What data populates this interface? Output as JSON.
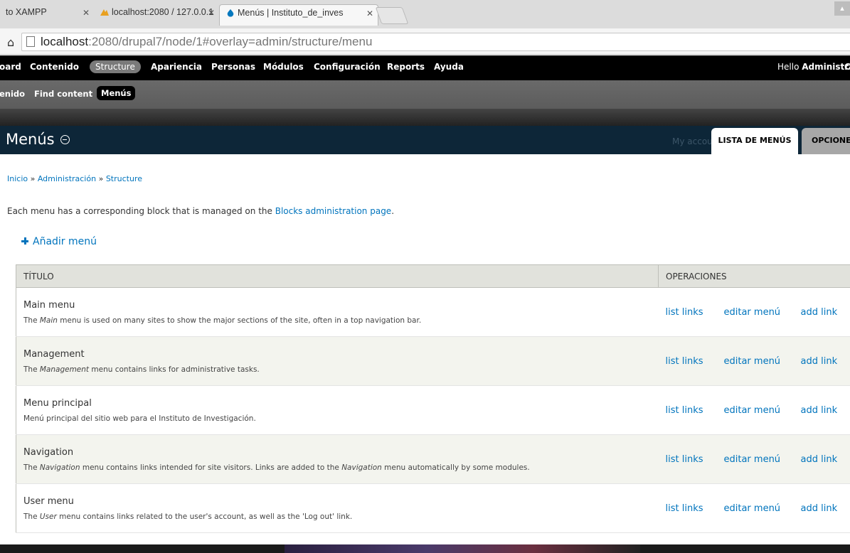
{
  "browser": {
    "tabs": [
      {
        "label": "to XAMPP"
      },
      {
        "label": "localhost:2080 / 127.0.0.1"
      },
      {
        "label": "Menús | Instituto_de_inves"
      }
    ],
    "url_host": "localhost",
    "url_rest": ":2080/drupal7/node/1#overlay=admin/structure/menu"
  },
  "toolbar": {
    "items": [
      "oard",
      "Contenido",
      "Structure",
      "Apariencia",
      "Personas",
      "Módulos",
      "Configuración",
      "Reports",
      "Ayuda"
    ],
    "hello_prefix": "Hello ",
    "hello_user": "Administrador",
    "trailing": "C"
  },
  "shortcuts": {
    "items": [
      "enido",
      "Find content",
      "Menús"
    ]
  },
  "overlay": {
    "title": "Menús",
    "my_account": "My account",
    "tabs": [
      "LISTA DE MENÚS",
      "OPCIONES"
    ]
  },
  "breadcrumb": {
    "items": [
      "Inicio",
      "Administración",
      "Structure"
    ],
    "separator": "»"
  },
  "help": {
    "before": "Each menu has a corresponding block that is managed on the ",
    "link": "Blocks administration page",
    "after": "."
  },
  "add_menu_label": "Añadir menú",
  "table": {
    "headers": [
      "TÍTULO",
      "OPERACIONES"
    ],
    "op_labels": [
      "list links",
      "editar menú",
      "add link"
    ],
    "rows": [
      {
        "name": "Main menu",
        "desc_pre": "The ",
        "desc_em": "Main",
        "desc_post": " menu is used on many sites to show the major sections of the site, often in a top navigation bar."
      },
      {
        "name": "Management",
        "desc_pre": "The ",
        "desc_em": "Management",
        "desc_post": " menu contains links for administrative tasks."
      },
      {
        "name": "Menu principal",
        "desc_pre": "Menú principal del sitio web para el Instituto de Investigación.",
        "desc_em": "",
        "desc_post": ""
      },
      {
        "name": "Navigation",
        "desc_pre": "The ",
        "desc_em": "Navigation",
        "desc_post": " menu contains links intended for site visitors. Links are added to the ",
        "desc_em2": "Navigation",
        "desc_post2": " menu automatically by some modules."
      },
      {
        "name": "User menu",
        "desc_pre": "The ",
        "desc_em": "User",
        "desc_post": " menu contains links related to the user's account, as well as the 'Log out' link."
      }
    ]
  },
  "colors": {
    "link": "#0074bd",
    "toolbar": "#000000",
    "overlay_title_bg": "#0d2638",
    "table_header_bg": "#e1e2dc",
    "row_even_bg": "#f3f4ee"
  }
}
